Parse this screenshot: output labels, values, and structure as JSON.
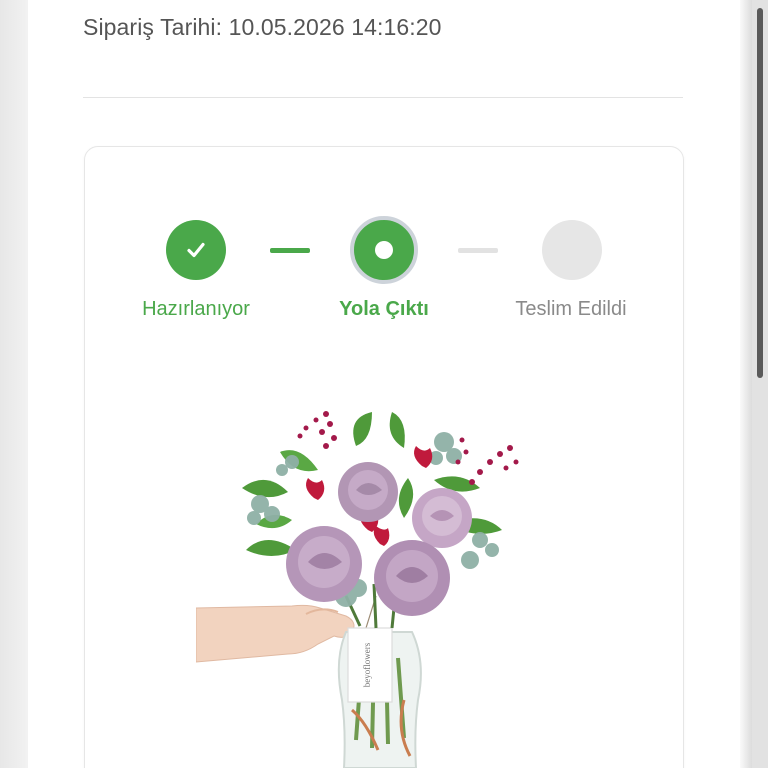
{
  "order": {
    "date_label": "Sipariş Tarihi: 10.05.2026 14:16:20"
  },
  "tracking": {
    "steps": [
      {
        "label": "Hazırlanıyor",
        "state": "completed",
        "icon": "check-icon"
      },
      {
        "label": "Yola Çıktı",
        "state": "active",
        "icon": "active-dot-icon"
      },
      {
        "label": "Teslim Edildi",
        "state": "pending",
        "icon": "empty-circle-icon"
      }
    ],
    "colors": {
      "completed": "#4aa84a",
      "active": "#4aa84a",
      "pending": "#e6e6e6",
      "pending_text": "#8a8a8a"
    }
  },
  "product": {
    "image": "flower-bouquet-in-glass-vase",
    "tag_text": "beyoflowers"
  }
}
